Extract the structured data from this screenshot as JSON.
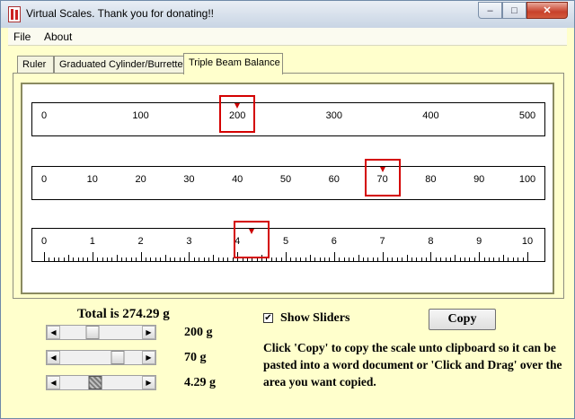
{
  "window": {
    "title": "Virtual Scales.  Thank you for donating!!",
    "min_label": "–",
    "max_label": "□",
    "close_label": "✕"
  },
  "menu": {
    "file": "File",
    "about": "About"
  },
  "tabs": [
    {
      "label": "Ruler",
      "active": false
    },
    {
      "label": "Graduated Cylinder/Burrette",
      "active": false
    },
    {
      "label": "Triple Beam Balance",
      "active": true
    }
  ],
  "scales": [
    {
      "min": 0,
      "max": 500,
      "labels": [
        "0",
        "100",
        "200",
        "300",
        "400",
        "500"
      ],
      "major_step": 100,
      "minor_step": 10,
      "pointer_value": 200
    },
    {
      "min": 0,
      "max": 100,
      "labels": [
        "0",
        "10",
        "20",
        "30",
        "40",
        "50",
        "60",
        "70",
        "80",
        "90",
        "100"
      ],
      "major_step": 10,
      "minor_step": 1,
      "pointer_value": 70
    },
    {
      "min": 0,
      "max": 10,
      "labels": [
        "0",
        "1",
        "2",
        "3",
        "4",
        "5",
        "6",
        "7",
        "8",
        "9",
        "10"
      ],
      "major_step": 1,
      "minor_step": 0.1,
      "pointer_value": 4.29
    }
  ],
  "total": "Total is 274.29 g",
  "sliders": [
    {
      "value_label": "200 g",
      "position": 0.4
    },
    {
      "value_label": "70 g",
      "position": 0.7
    },
    {
      "value_label": "4.29 g",
      "position": 0.429
    }
  ],
  "show_sliders": {
    "label": "Show Sliders",
    "checked": true,
    "check_mark": "✔"
  },
  "copy_button": "Copy",
  "instructions": "Click 'Copy' to copy the scale unto clipboard so it can be pasted into a word document or 'Click and Drag' over the area you want copied."
}
